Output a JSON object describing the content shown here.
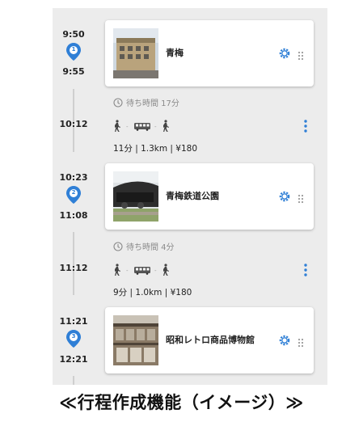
{
  "accent_color": "#2f7fd6",
  "stops": [
    {
      "number": "1",
      "arrive": "9:50",
      "depart": "9:55",
      "name": "青梅",
      "settings_icon": "gear-icon",
      "drag_icon": "drag-handle-icon"
    },
    {
      "number": "2",
      "arrive": "10:23",
      "depart": "11:08",
      "name": "青梅鉄道公園",
      "settings_icon": "gear-icon",
      "drag_icon": "drag-handle-icon"
    },
    {
      "number": "3",
      "arrive": "11:21",
      "depart": "12:21",
      "name": "昭和レトロ商品博物館",
      "settings_icon": "gear-icon",
      "drag_icon": "drag-handle-icon"
    }
  ],
  "transits": [
    {
      "wait": "待ち時間 17分",
      "depart_time": "10:12",
      "summary": "11分 | 1.3km | ¥180",
      "modes": [
        "walk",
        "bus",
        "walk"
      ]
    },
    {
      "wait": "待ち時間 4分",
      "depart_time": "11:12",
      "summary": "9分 | 1.0km | ¥180",
      "modes": [
        "walk",
        "bus",
        "walk"
      ]
    }
  ],
  "caption": "≪行程作成機能（イメージ）≫"
}
